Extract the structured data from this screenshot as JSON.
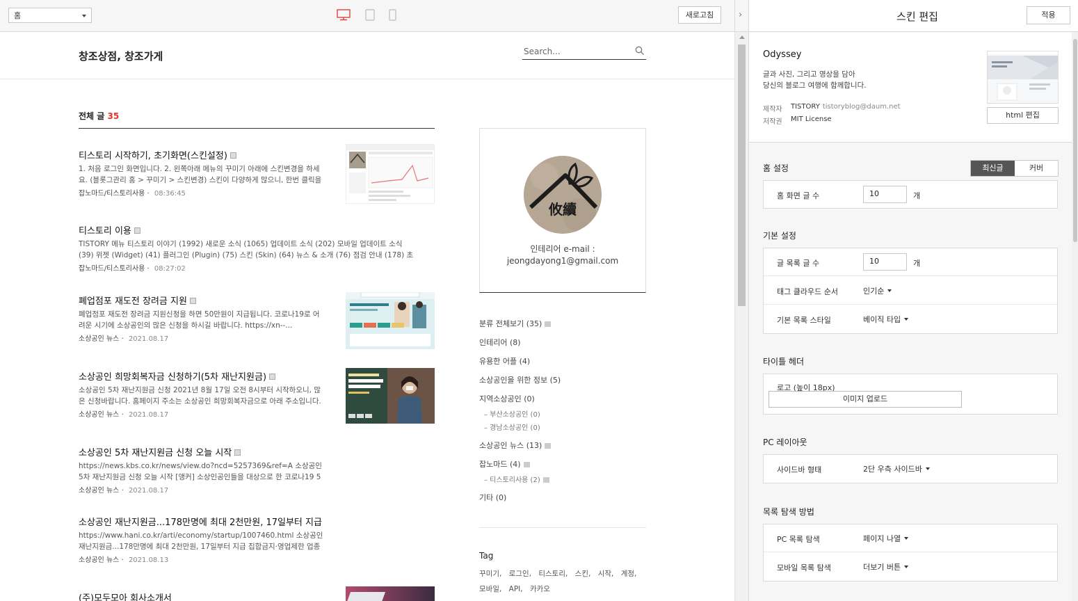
{
  "toolbar": {
    "page_select": "홈",
    "refresh_label": "새로고침",
    "devices": [
      "desktop",
      "tablet",
      "mobile"
    ]
  },
  "blog": {
    "title": "창조상점, 창조가게",
    "search_placeholder": "Search...",
    "total_label": "전체 글",
    "total_count": "35"
  },
  "posts": [
    {
      "title": "티스토리 시작하기, 초기화면(스킨설정)",
      "excerpt": "1. 처음 로그인 화면입니다. 2. 왼쪽아래 메뉴의 꾸미기 아래에 스킨변경을 하세요. (블롯그관리 홈 > 꾸미기 > 스킨변경) 스킨이 다양하게 많으니, 한번 클릭을 하셔...",
      "category": "잡노마드/티스토리사용",
      "time": "08:36:45",
      "has_thumb": true
    },
    {
      "title": "티스토리 이용",
      "excerpt": "TISTORY 메뉴 티스토리 이야기 (1992) 새로운 소식 (1065) 업데이트 소식 (202) 모바일 업데이트 소식 (39) 위젯 (Widget) (41) 플러그인 (Plugin) (75) 스킨 (Skin) (64) 뉴스 & 소개 (76) 점검 안내 (178) 초대장 배포 (120) 이...",
      "category": "잡노마드/티스토리사용",
      "time": "08:27:02",
      "has_thumb": false
    },
    {
      "title": "폐업점포 재도전 장려금 지원",
      "excerpt": "폐업점포 재도전 장려금 지원신청을 하면 50만원이 지급됩니다. 코로나19로 어려운 시기에 소상공인의 많은 신청을 하시길 바랍니다. https://xn--...",
      "category": "소상공인 뉴스",
      "time": "2021.08.17",
      "has_thumb": true
    },
    {
      "title": "소상공인 희망회복자금 신청하기(5차 재난지원금)",
      "excerpt": "소상공인 5차 재난지원금 신청 2021년 8월 17일 오전 8시부터 시작하오니, 많은 신청바랍니다. 홈페이지 주소는 소상공인 희망회복자금으로 아래 주소입니다.(글...",
      "category": "소상공인 뉴스",
      "time": "2021.08.17",
      "has_thumb": true
    },
    {
      "title": "소상공인 5차 재난지원금 신청 오늘 시작",
      "excerpt": "https://news.kbs.co.kr/news/view.do?ncd=5257369&ref=A 소상공인 5차 재난지원금 신청 오늘 시작 [앵커] 소상인공인들을 대상으로 한 코로나19 5차 재난지원금 신청이 오늘 오전부터 시작됩니다. 처음 이틀......",
      "category": "소상공인 뉴스",
      "time": "2021.08.17",
      "has_thumb": false
    },
    {
      "title": "소상공인 재난지원금...178만명에 최대 2천만원, 17일부터 지급",
      "excerpt": "https://www.hani.co.kr/arti/economy/startup/1007460.html 소상공인 재난지원금...178만명에 최대 2천만원, 17일부터 지급 집합금지·영업제한 업종 17...",
      "category": "소상공인 뉴스",
      "time": "2021.08.13",
      "has_thumb": false
    },
    {
      "title": "(주)모두모아 회사소개서",
      "excerpt": "",
      "category": "",
      "time": "",
      "has_thumb": true
    }
  ],
  "profile": {
    "logo_text": "攸續",
    "line1": "인테리어 e-mail :",
    "line2": "jeongdayong1@gmail.com"
  },
  "categories": [
    {
      "label": "분류 전체보기 (35)",
      "sub": false,
      "new": true
    },
    {
      "label": "인테리어 (8)",
      "sub": false,
      "new": false
    },
    {
      "label": "유용한 어플 (4)",
      "sub": false,
      "new": false
    },
    {
      "label": "소상공인을 위한 정보 (5)",
      "sub": false,
      "new": false
    },
    {
      "label": "지역소상공인 (0)",
      "sub": false,
      "new": false
    },
    {
      "label": "– 부산소상공인 (0)",
      "sub": true,
      "new": false
    },
    {
      "label": "– 경남소상공인 (0)",
      "sub": true,
      "new": false
    },
    {
      "label": "소상공인 뉴스 (13)",
      "sub": false,
      "new": true
    },
    {
      "label": "잡노마드 (4)",
      "sub": false,
      "new": true
    },
    {
      "label": "– 티스토리사용 (2)",
      "sub": true,
      "new": true
    },
    {
      "label": "기타 (0)",
      "sub": false,
      "new": false
    }
  ],
  "tags": {
    "title": "Tag",
    "items": [
      "꾸미기,",
      "로그인,",
      "티스토리,",
      "스킨,",
      "시작,",
      "계정,",
      "모바일,",
      "API,",
      "카카오"
    ]
  },
  "editor": {
    "title": "스킨 편집",
    "apply_label": "적용",
    "skin_name": "Odyssey",
    "skin_desc1": "글과 사진, 그리고 영상을 담아",
    "skin_desc2": "당신의 블로그 여행에 함께합니다.",
    "maker_label": "제작자",
    "maker_value": "TISTORY",
    "maker_email": "tistoryblog@daum.net",
    "license_label": "저작권",
    "license_value": "MIT License",
    "html_edit_label": "html 편집",
    "home": {
      "title": "홈 설정",
      "seg_recent": "최신글",
      "seg_cover": "커버",
      "posts_label": "홈 화면 글 수",
      "posts_value": "10",
      "unit": "개"
    },
    "basic": {
      "title": "기본 설정",
      "list_label": "글 목록 글 수",
      "list_value": "10",
      "unit": "개",
      "tag_order_label": "태그 클라우드 순서",
      "tag_order_value": "인기순",
      "list_style_label": "기본 목록 스타일",
      "list_style_value": "베이직 타입"
    },
    "title_header": {
      "title": "타이틀 헤더",
      "logo_label": "로고 (높이 18px)",
      "upload_label": "이미지 업로드"
    },
    "pc_layout": {
      "title": "PC 레이아웃",
      "sidebar_label": "사이드바 형태",
      "sidebar_value": "2단 우측 사이드바"
    },
    "list_nav": {
      "title": "목록 탐색 방법",
      "pc_label": "PC 목록 탐색",
      "pc_value": "페이지 나열",
      "mobile_label": "모바일 목록 탐색",
      "mobile_value": "더보기 버튼"
    }
  },
  "colors": {
    "accent_red": "#e0332b",
    "device_active": "#e0332b",
    "segment_active": "#555555"
  }
}
